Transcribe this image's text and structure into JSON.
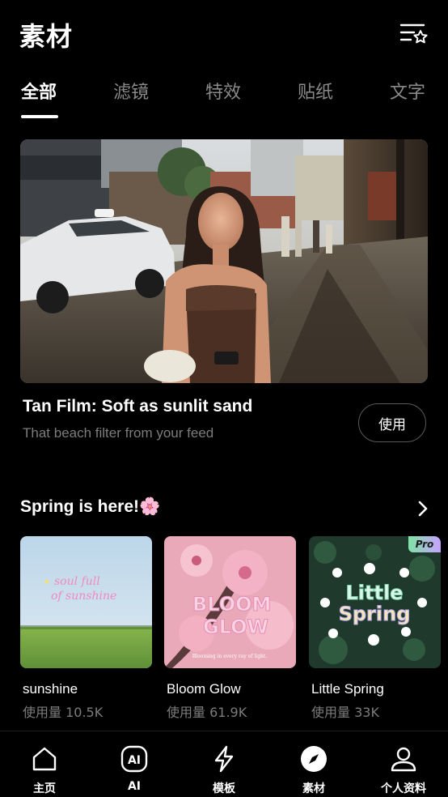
{
  "header": {
    "title": "素材"
  },
  "tabs": [
    {
      "label": "全部",
      "active": true
    },
    {
      "label": "滤镜",
      "active": false
    },
    {
      "label": "特效",
      "active": false
    },
    {
      "label": "贴纸",
      "active": false
    },
    {
      "label": "文字",
      "active": false
    }
  ],
  "featured": {
    "title": "Tan Film: Soft as sunlit sand",
    "subtitle": "That beach filter from your feed",
    "button_label": "使用"
  },
  "section": {
    "title": "Spring is here!🌸"
  },
  "cards": [
    {
      "name": "sunshine",
      "usage": "使用量 10.5K",
      "art_text_1": "soul full",
      "art_text_2": "of sunshine"
    },
    {
      "name": "Bloom Glow",
      "usage": "使用量 61.9K",
      "art_text_1": "BLOOM",
      "art_text_2": "GLOW",
      "art_caption": "Blooming in every ray of light."
    },
    {
      "name": "Little Spring",
      "usage": "使用量 33K",
      "art_text_1": "Little",
      "art_text_2": "Spring",
      "badge": "Pro"
    }
  ],
  "bottom_nav": [
    {
      "label": "主页",
      "icon": "home-icon"
    },
    {
      "label": "AI",
      "icon": "ai-icon"
    },
    {
      "label": "模板",
      "icon": "lightning-icon"
    },
    {
      "label": "素材",
      "icon": "compass-icon",
      "active": true
    },
    {
      "label": "个人资料",
      "icon": "profile-icon"
    }
  ],
  "colors": {
    "background": "#000000",
    "muted_text": "#7c7c7c",
    "pro_gradient_start": "#7fe3a5",
    "pro_gradient_end": "#c8a2ff"
  }
}
